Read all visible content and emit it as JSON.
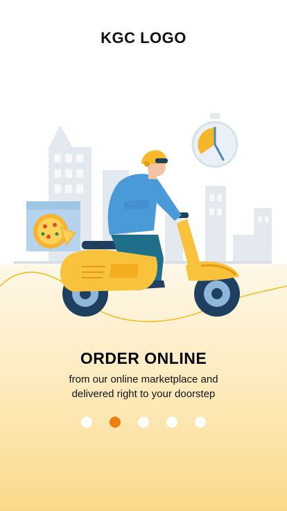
{
  "header": {
    "logo_text": "KGC LOGO"
  },
  "slide": {
    "title": "ORDER ONLINE",
    "subtitle_line1": "from our online marketplace and",
    "subtitle_line2": "delivered right to your doorstep"
  },
  "pagination": {
    "total": 5,
    "active_index": 1
  },
  "colors": {
    "accent": "#f07d12",
    "scooter": "#f9c23c",
    "rider_shirt": "#4a9ad8"
  }
}
